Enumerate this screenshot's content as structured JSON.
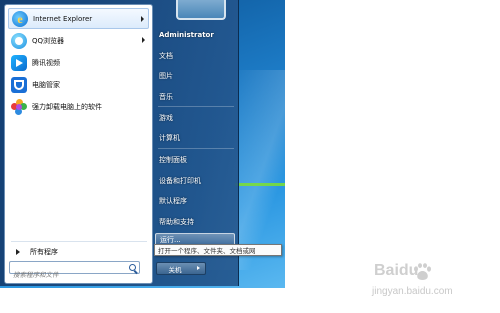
{
  "start_menu": {
    "programs": [
      {
        "label": "Internet Explorer",
        "icon": "internet-explorer-icon",
        "has_submenu": true
      },
      {
        "label": "QQ浏览器",
        "icon": "qq-browser-icon",
        "has_submenu": true
      },
      {
        "label": "腾讯视频",
        "icon": "tencent-video-icon",
        "has_submenu": false
      },
      {
        "label": "电脑管家",
        "icon": "pc-manager-icon",
        "has_submenu": false
      },
      {
        "label": "强力卸载电脑上的软件",
        "icon": "uninstaller-icon",
        "has_submenu": false
      }
    ],
    "all_programs": "所有程序",
    "search_placeholder": "搜索程序和文件",
    "right_pane": {
      "user": "Administrator",
      "items": [
        "文档",
        "图片",
        "音乐",
        "游戏",
        "计算机",
        "控制面板",
        "设备和打印机",
        "默认程序",
        "帮助和支持"
      ],
      "run": "运行..."
    },
    "shutdown_label": "关机",
    "run_tooltip": "打开一个程序、文件夹、文档或网"
  },
  "watermark": {
    "logo_text": "Baidu",
    "site": "jingyan.baidu.com"
  },
  "colors": {
    "menu_dark": "#14406e",
    "desktop_blue": "#1d7cc7",
    "accent_green": "#7ee12f"
  }
}
